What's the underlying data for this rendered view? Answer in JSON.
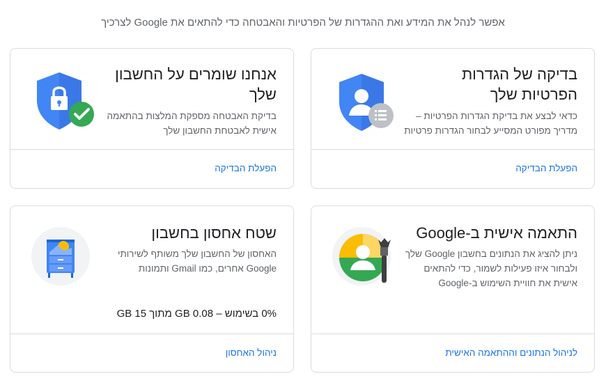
{
  "intro_text": "אפשר לנהל את המידע ואת ההגדרות של הפרטיות והאבטחה כדי להתאים את Google לצרכיך",
  "cards": [
    {
      "title": "בדיקה של הגדרות הפרטיות שלך",
      "description": "כדאי לבצע את בדיקת הגדרות הפרטיות – מדריך מפורט המסייע לבחור הגדרות פרטיות",
      "link": "הפעלת הבדיקה",
      "illustration": "privacy-shield-person-icon"
    },
    {
      "title": "אנחנו שומרים על החשבון שלך",
      "description": "בדיקת האבטחה מספקת המלצות בהתאמה אישית לאבטחת החשבון שלך",
      "link": "הפעלת הבדיקה",
      "illustration": "security-shield-lock-icon"
    },
    {
      "title": "התאמה אישית ב-Google",
      "description": "ניתן להציג את הנתונים בחשבון Google שלך ולבחור איזו פעילות לשמור, כדי להתאים אישית את חוויית השימוש ב-Google",
      "link": "לניהול הנתונים וההתאמה האישית",
      "illustration": "personalization-brush-icon"
    },
    {
      "title": "שטח אחסון בחשבון",
      "description": "האחסון של החשבון שלך משותף לשירותי Google אחרים, כמו Gmail ותמונות",
      "storage_usage": "0% בשימוש – 0.08 GB מתוך 15 GB",
      "link": "ניהול האחסון",
      "illustration": "storage-cabinet-icon"
    }
  ],
  "colors": {
    "accent_blue": "#1a73e8",
    "shield_blue": "#4285f4",
    "check_green": "#34a853",
    "yellow": "#fbbc04"
  }
}
